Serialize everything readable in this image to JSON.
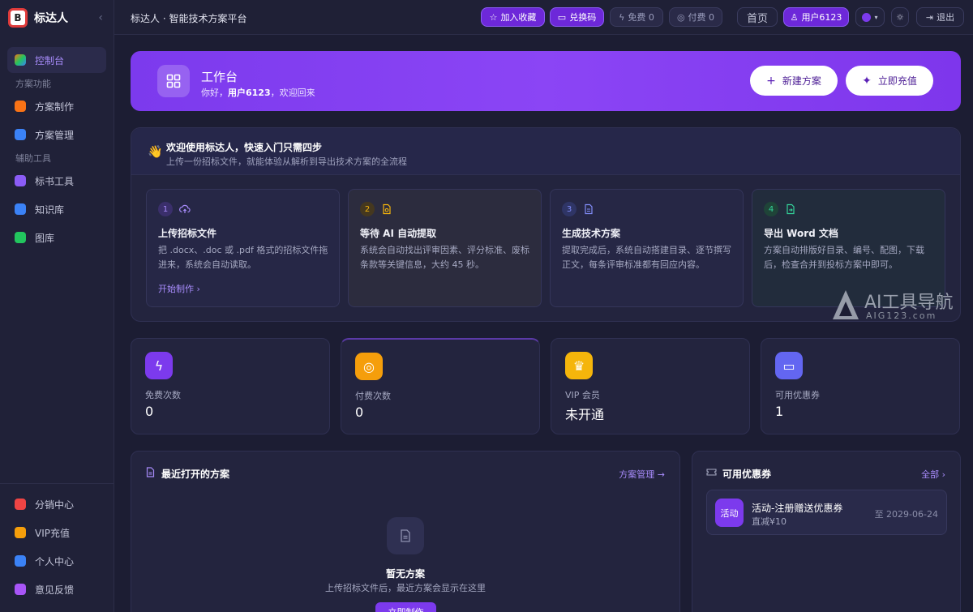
{
  "brand": {
    "logo": "B",
    "name": "标达人",
    "collapse_icon": "chevron-left-icon"
  },
  "sidebar": {
    "items": [
      {
        "label": "控制台",
        "icon": "dashboard-icon",
        "active": true,
        "color": "#f97316"
      },
      {
        "label": "方案制作",
        "icon": "edit-icon",
        "color": "#f97316"
      },
      {
        "label": "方案管理",
        "icon": "folder-icon",
        "color": "#3b82f6"
      },
      {
        "label": "标书工具",
        "icon": "tool-icon",
        "color": "#8b5cf6"
      },
      {
        "label": "知识库",
        "icon": "book-icon",
        "color": "#3b82f6"
      },
      {
        "label": "图库",
        "icon": "image-icon",
        "color": "#22c55e"
      }
    ],
    "sections": [
      "方案功能",
      "辅助工具"
    ],
    "bottom_items": [
      {
        "label": "分销中心",
        "icon": "gift-icon",
        "color": "#ef4444"
      },
      {
        "label": "VIP充值",
        "icon": "vip-icon",
        "color": "#f59e0b"
      },
      {
        "label": "个人中心",
        "icon": "user-icon",
        "color": "#3b82f6"
      },
      {
        "label": "意见反馈",
        "icon": "feedback-icon",
        "color": "#a855f7"
      }
    ]
  },
  "topbar": {
    "breadcrumb": "标达人 · 智能技术方案平台",
    "favorite": "加入收藏",
    "redeem": "兑换码",
    "free": "免费 0",
    "paid": "付费 0",
    "home": "首页",
    "user": "用户6123",
    "logout": "退出"
  },
  "hero": {
    "title": "工作台",
    "greeting_prefix": "你好，",
    "user": "用户6123",
    "greeting_suffix": "，欢迎回来",
    "new_plan": "新建方案",
    "recharge": "立即充值"
  },
  "welcome": {
    "title": "欢迎使用标达人，快速入门只需四步",
    "subtitle": "上传一份招标文件，就能体验从解析到导出技术方案的全流程",
    "steps": [
      {
        "num": "1",
        "title": "上传招标文件",
        "desc": "把 .docx、.doc 或 .pdf 格式的招标文件拖进来，系统会自动读取。",
        "link": "开始制作 ›"
      },
      {
        "num": "2",
        "title": "等待 AI 自动提取",
        "desc": "系统会自动找出评审因素、评分标准、废标条款等关键信息，大约 45 秒。"
      },
      {
        "num": "3",
        "title": "生成技术方案",
        "desc": "提取完成后，系统自动搭建目录、逐节撰写正文，每条评审标准都有回应内容。"
      },
      {
        "num": "4",
        "title": "导出 Word 文档",
        "desc": "方案自动排版好目录、编号、配图，下载后，检查合并到投标方案中即可。"
      }
    ]
  },
  "stats": [
    {
      "label": "免费次数",
      "value": "0",
      "icon": "bolt-icon",
      "color": "#7c3aed"
    },
    {
      "label": "付费次数",
      "value": "0",
      "icon": "coins-icon",
      "color": "#f59e0b"
    },
    {
      "label": "VIP 会员",
      "value": "未开通",
      "icon": "crown-icon",
      "color": "#f5b50b"
    },
    {
      "label": "可用优惠券",
      "value": "1",
      "icon": "ticket-icon",
      "color": "#6366f1"
    }
  ],
  "recent": {
    "title": "最近打开的方案",
    "link": "方案管理 →",
    "empty_title": "暂无方案",
    "empty_sub": "上传招标文件后，最近方案会显示在这里",
    "empty_button": "立即制作"
  },
  "coupons": {
    "title": "可用优惠券",
    "link": "全部 ›",
    "items": [
      {
        "tag": "活动",
        "name": "活动-注册赠送优惠券",
        "amount": "直减¥10",
        "expire": "至 2029-06-24"
      }
    ]
  },
  "watermark": {
    "line1": "AI工具导航",
    "line2": "AIG123.com"
  }
}
